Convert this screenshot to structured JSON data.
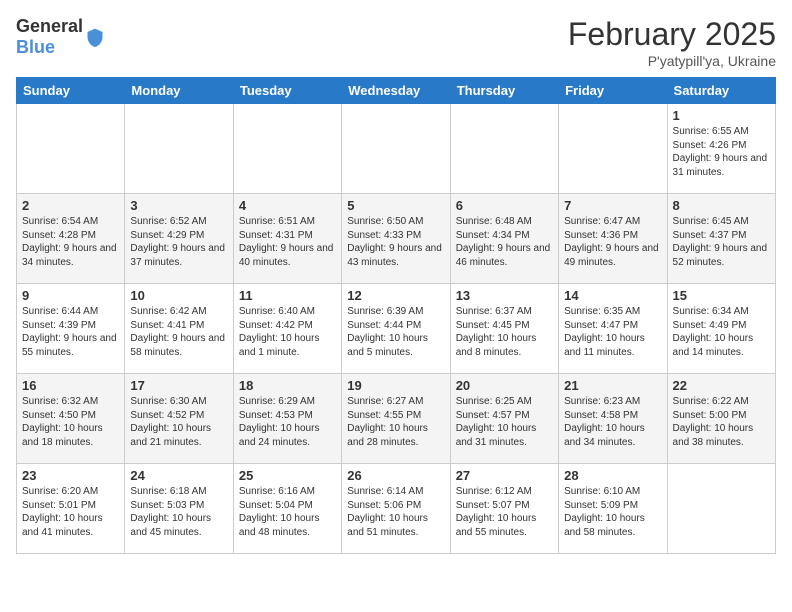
{
  "header": {
    "logo": {
      "general": "General",
      "blue": "Blue"
    },
    "title": "February 2025",
    "subtitle": "P'yatypill'ya, Ukraine"
  },
  "calendar": {
    "weekdays": [
      "Sunday",
      "Monday",
      "Tuesday",
      "Wednesday",
      "Thursday",
      "Friday",
      "Saturday"
    ],
    "weeks": [
      [
        {
          "day": "",
          "info": ""
        },
        {
          "day": "",
          "info": ""
        },
        {
          "day": "",
          "info": ""
        },
        {
          "day": "",
          "info": ""
        },
        {
          "day": "",
          "info": ""
        },
        {
          "day": "",
          "info": ""
        },
        {
          "day": "1",
          "info": "Sunrise: 6:55 AM\nSunset: 4:26 PM\nDaylight: 9 hours and 31 minutes."
        }
      ],
      [
        {
          "day": "2",
          "info": "Sunrise: 6:54 AM\nSunset: 4:28 PM\nDaylight: 9 hours and 34 minutes."
        },
        {
          "day": "3",
          "info": "Sunrise: 6:52 AM\nSunset: 4:29 PM\nDaylight: 9 hours and 37 minutes."
        },
        {
          "day": "4",
          "info": "Sunrise: 6:51 AM\nSunset: 4:31 PM\nDaylight: 9 hours and 40 minutes."
        },
        {
          "day": "5",
          "info": "Sunrise: 6:50 AM\nSunset: 4:33 PM\nDaylight: 9 hours and 43 minutes."
        },
        {
          "day": "6",
          "info": "Sunrise: 6:48 AM\nSunset: 4:34 PM\nDaylight: 9 hours and 46 minutes."
        },
        {
          "day": "7",
          "info": "Sunrise: 6:47 AM\nSunset: 4:36 PM\nDaylight: 9 hours and 49 minutes."
        },
        {
          "day": "8",
          "info": "Sunrise: 6:45 AM\nSunset: 4:37 PM\nDaylight: 9 hours and 52 minutes."
        }
      ],
      [
        {
          "day": "9",
          "info": "Sunrise: 6:44 AM\nSunset: 4:39 PM\nDaylight: 9 hours and 55 minutes."
        },
        {
          "day": "10",
          "info": "Sunrise: 6:42 AM\nSunset: 4:41 PM\nDaylight: 9 hours and 58 minutes."
        },
        {
          "day": "11",
          "info": "Sunrise: 6:40 AM\nSunset: 4:42 PM\nDaylight: 10 hours and 1 minute."
        },
        {
          "day": "12",
          "info": "Sunrise: 6:39 AM\nSunset: 4:44 PM\nDaylight: 10 hours and 5 minutes."
        },
        {
          "day": "13",
          "info": "Sunrise: 6:37 AM\nSunset: 4:45 PM\nDaylight: 10 hours and 8 minutes."
        },
        {
          "day": "14",
          "info": "Sunrise: 6:35 AM\nSunset: 4:47 PM\nDaylight: 10 hours and 11 minutes."
        },
        {
          "day": "15",
          "info": "Sunrise: 6:34 AM\nSunset: 4:49 PM\nDaylight: 10 hours and 14 minutes."
        }
      ],
      [
        {
          "day": "16",
          "info": "Sunrise: 6:32 AM\nSunset: 4:50 PM\nDaylight: 10 hours and 18 minutes."
        },
        {
          "day": "17",
          "info": "Sunrise: 6:30 AM\nSunset: 4:52 PM\nDaylight: 10 hours and 21 minutes."
        },
        {
          "day": "18",
          "info": "Sunrise: 6:29 AM\nSunset: 4:53 PM\nDaylight: 10 hours and 24 minutes."
        },
        {
          "day": "19",
          "info": "Sunrise: 6:27 AM\nSunset: 4:55 PM\nDaylight: 10 hours and 28 minutes."
        },
        {
          "day": "20",
          "info": "Sunrise: 6:25 AM\nSunset: 4:57 PM\nDaylight: 10 hours and 31 minutes."
        },
        {
          "day": "21",
          "info": "Sunrise: 6:23 AM\nSunset: 4:58 PM\nDaylight: 10 hours and 34 minutes."
        },
        {
          "day": "22",
          "info": "Sunrise: 6:22 AM\nSunset: 5:00 PM\nDaylight: 10 hours and 38 minutes."
        }
      ],
      [
        {
          "day": "23",
          "info": "Sunrise: 6:20 AM\nSunset: 5:01 PM\nDaylight: 10 hours and 41 minutes."
        },
        {
          "day": "24",
          "info": "Sunrise: 6:18 AM\nSunset: 5:03 PM\nDaylight: 10 hours and 45 minutes."
        },
        {
          "day": "25",
          "info": "Sunrise: 6:16 AM\nSunset: 5:04 PM\nDaylight: 10 hours and 48 minutes."
        },
        {
          "day": "26",
          "info": "Sunrise: 6:14 AM\nSunset: 5:06 PM\nDaylight: 10 hours and 51 minutes."
        },
        {
          "day": "27",
          "info": "Sunrise: 6:12 AM\nSunset: 5:07 PM\nDaylight: 10 hours and 55 minutes."
        },
        {
          "day": "28",
          "info": "Sunrise: 6:10 AM\nSunset: 5:09 PM\nDaylight: 10 hours and 58 minutes."
        },
        {
          "day": "",
          "info": ""
        }
      ]
    ]
  }
}
